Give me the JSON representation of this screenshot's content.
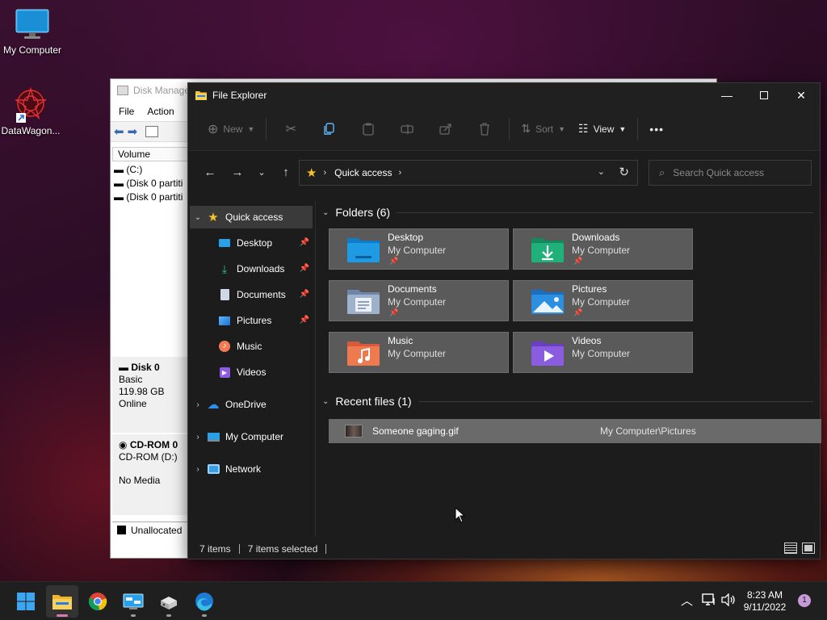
{
  "desktop": {
    "icons": [
      {
        "label": "My Computer",
        "icon": "monitor-icon"
      },
      {
        "label": "DataWagon...",
        "icon": "datawagon-shortcut-icon"
      }
    ]
  },
  "disk_management": {
    "title": "Disk Manage",
    "menu": [
      "File",
      "Action"
    ],
    "volume_header": "Volume",
    "volumes": [
      "(C:)",
      "(Disk 0 partiti",
      "(Disk 0 partiti"
    ],
    "disk0": {
      "name": "Disk 0",
      "type": "Basic",
      "size": "119.98 GB",
      "status": "Online"
    },
    "cdrom0": {
      "name": "CD-ROM 0",
      "drive": "CD-ROM (D:)",
      "media": "No Media"
    },
    "legend_unallocated": "Unallocated"
  },
  "file_explorer": {
    "title": "File Explorer",
    "commands": {
      "new": "New",
      "sort": "Sort",
      "view": "View",
      "more": "•••"
    },
    "address": {
      "location": "Quick access"
    },
    "search": {
      "placeholder": "Search Quick access"
    },
    "nav": {
      "quick_access": "Quick access",
      "pinned": [
        {
          "label": "Desktop",
          "pinned": true
        },
        {
          "label": "Downloads",
          "pinned": true
        },
        {
          "label": "Documents",
          "pinned": true
        },
        {
          "label": "Pictures",
          "pinned": true
        },
        {
          "label": "Music",
          "pinned": false
        },
        {
          "label": "Videos",
          "pinned": false
        }
      ],
      "onedrive": "OneDrive",
      "my_computer": "My Computer",
      "network": "Network"
    },
    "folders_header": "Folders (6)",
    "folders": [
      {
        "name": "Desktop",
        "location": "My Computer",
        "color": "#1e9be4"
      },
      {
        "name": "Downloads",
        "location": "My Computer",
        "color": "#20b07a"
      },
      {
        "name": "Documents",
        "location": "My Computer",
        "color": "#8aa0c0"
      },
      {
        "name": "Pictures",
        "location": "My Computer",
        "color": "#2d8fe0"
      },
      {
        "name": "Music",
        "location": "My Computer",
        "color": "#f07a50"
      },
      {
        "name": "Videos",
        "location": "My Computer",
        "color": "#8a5ce0"
      }
    ],
    "recent_header": "Recent files (1)",
    "recent_files": [
      {
        "name": "Someone gaging.gif",
        "path": "My Computer\\Pictures"
      }
    ],
    "status": {
      "items": "7 items",
      "selected": "7 items selected"
    }
  },
  "taskbar": {
    "apps": [
      "start-icon",
      "file-explorer-icon",
      "chrome-icon",
      "control-panel-icon",
      "disk-management-icon",
      "edge-icon"
    ],
    "time": "8:23 AM",
    "date": "9/11/2022",
    "notifications": "1"
  }
}
